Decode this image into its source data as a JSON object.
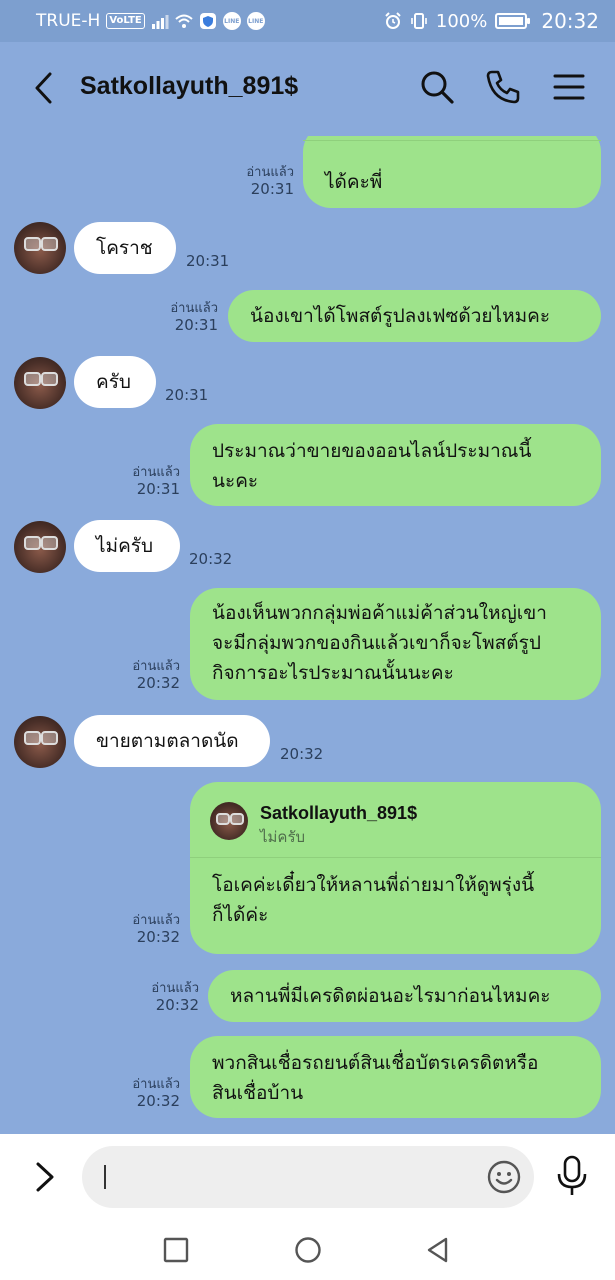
{
  "status_bar": {
    "carrier": "TRUE-H",
    "network_badge": "VoLTE",
    "battery": "100%",
    "battery_level": 1.0,
    "time": "20:32",
    "app_notification_label": "LINE"
  },
  "header": {
    "title": "Satkollayuth_891$",
    "icons": [
      "back-icon",
      "search-icon",
      "phone-icon",
      "menu-icon"
    ]
  },
  "messages": [
    {
      "from": "me",
      "text": "ได้คะพี่",
      "read": "อ่านแล้ว",
      "time": "20:31"
    },
    {
      "from": "them",
      "text": "โคราช",
      "time": "20:31"
    },
    {
      "from": "me",
      "text": "น้องเขาได้โพสต์รูปลงเฟซด้วยไหมคะ",
      "read": "อ่านแล้ว",
      "time": "20:31"
    },
    {
      "from": "them",
      "text": "ครับ",
      "time": "20:31"
    },
    {
      "from": "me",
      "lines": [
        "ประมาณว่าขายของออนไลน์ประมาณนี้",
        "นะคะ"
      ],
      "read": "อ่านแล้ว",
      "time": "20:31"
    },
    {
      "from": "them",
      "text": "ไม่ครับ",
      "time": "20:32"
    },
    {
      "from": "me",
      "lines": [
        "น้องเห็นพวกกลุ่มพ่อค้าแม่ค้าส่วนใหญ่เขา",
        "จะมีกลุ่มพวกของกินแล้วเขาก็จะโพสต์รูป",
        "กิจการอะไรประมาณนั้นนะคะ"
      ],
      "read": "อ่านแล้ว",
      "time": "20:32"
    },
    {
      "from": "them",
      "text": "ขายตามตลาดนัด",
      "time": "20:32"
    },
    {
      "from": "me",
      "reply_to": {
        "name": "Satkollayuth_891$",
        "text": "ไม่ครับ"
      },
      "lines": [
        "โอเคค่ะเดี๋ยวให้หลานพี่ถ่ายมาให้ดูพรุ่งนี้",
        "ก็ได้ค่ะ"
      ],
      "read": "อ่านแล้ว",
      "time": "20:32"
    },
    {
      "from": "me",
      "text": "หลานพี่มีเครดิตผ่อนอะไรมาก่อนไหมคะ",
      "read": "อ่านแล้ว",
      "time": "20:32"
    },
    {
      "from": "me",
      "lines": [
        "พวกสินเชื่อรถยนต์สินเชื่อบัตรเครดิตหรือ",
        "สินเชื่อบ้าน"
      ],
      "read": "อ่านแล้ว",
      "time": "20:32"
    }
  ],
  "input": {
    "placeholder": "",
    "value": ""
  },
  "nav_icons": [
    "recent-apps-icon",
    "home-icon",
    "back-nav-icon"
  ]
}
